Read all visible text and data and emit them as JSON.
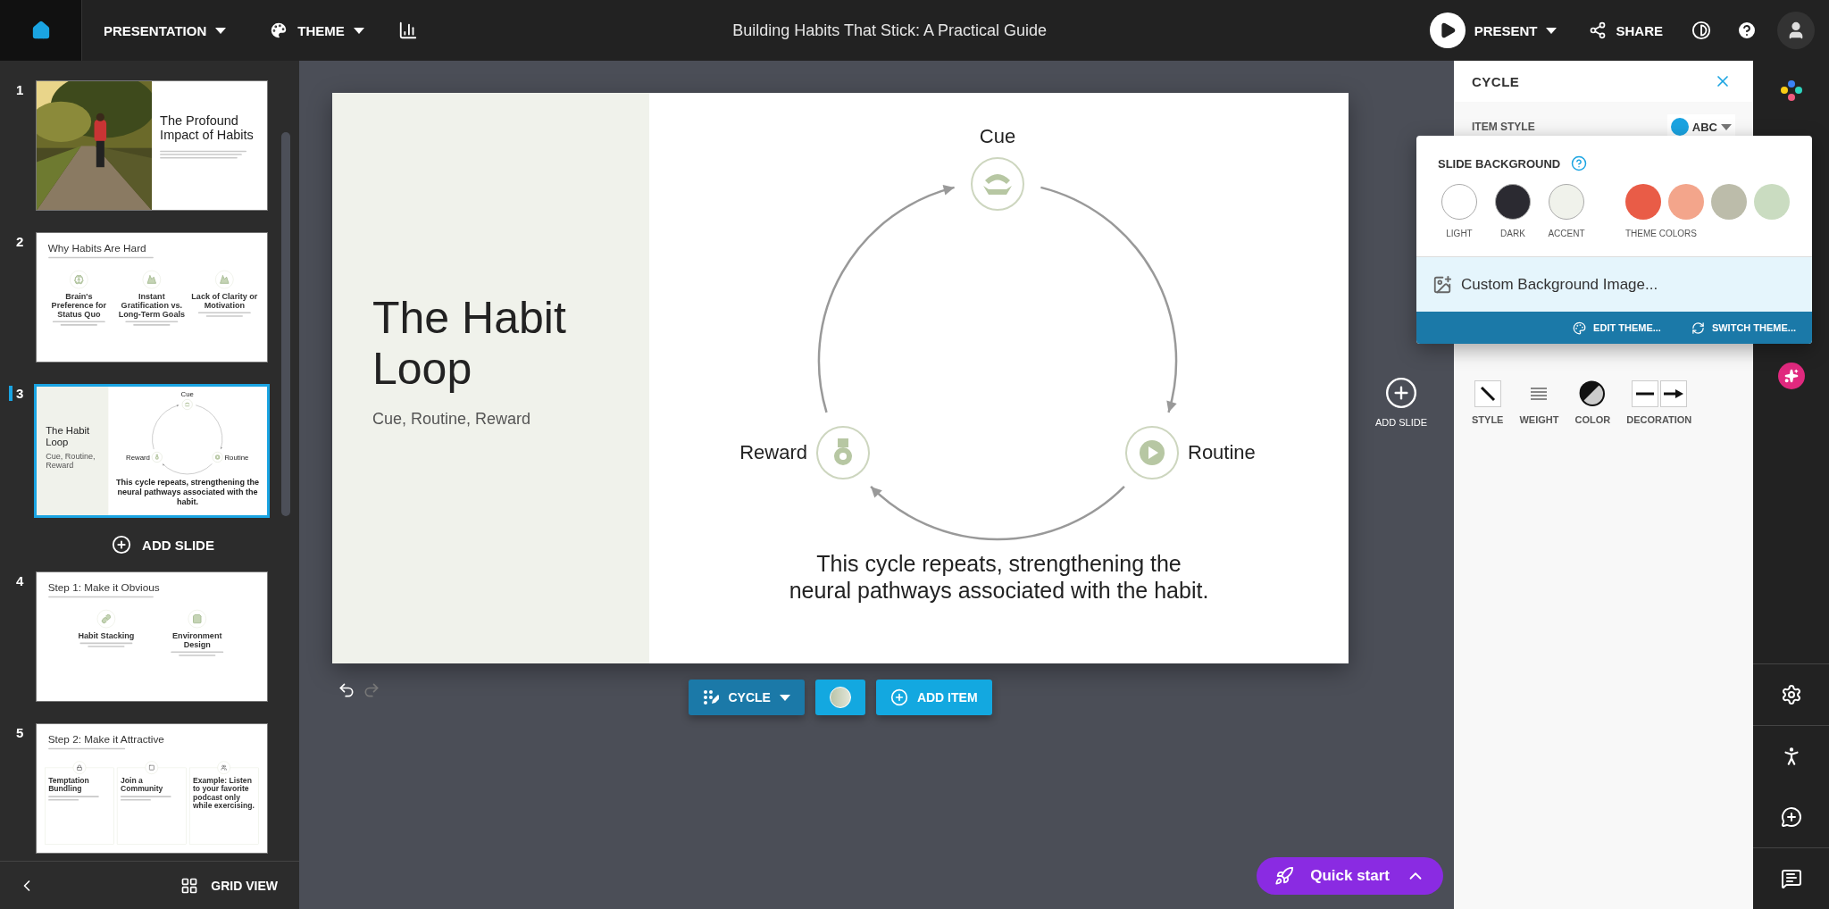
{
  "top_bar": {
    "menus": [
      {
        "label": "PRESENTATION",
        "kind": "presentation"
      },
      {
        "label": "THEME",
        "kind": "theme"
      }
    ],
    "title": "Building Habits That Stick: A Practical Guide",
    "present": "PRESENT",
    "share": "SHARE"
  },
  "slides_panel": {
    "slides": [
      {
        "number": "1",
        "selected": false,
        "kind": "photo_title",
        "title": "The Profound Impact of Habits"
      },
      {
        "number": "2",
        "selected": false,
        "kind": "icon_columns",
        "title": "Why Habits Are Hard",
        "items": [
          "Brain's Preference for Status Quo",
          "Instant Gratification vs. Long-Term Goals",
          "Lack of Clarity or Motivation"
        ]
      },
      {
        "number": "3",
        "selected": true,
        "kind": "cycle",
        "title": "The Habit Loop",
        "subtitle": "Cue, Routine, Reward",
        "nodes": [
          "Cue",
          "Routine",
          "Reward"
        ],
        "caption": "This cycle repeats, strengthening the neural pathways associated with the habit."
      },
      {
        "number": "4",
        "selected": false,
        "kind": "icon_columns",
        "title": "Step 1: Make it Obvious",
        "items": [
          "Habit Stacking",
          "Environment Design"
        ]
      },
      {
        "number": "5",
        "selected": false,
        "kind": "cards",
        "title": "Step 2: Make it Attractive",
        "items": [
          "Temptation Bundling",
          "Join a Community",
          "Example: Listen to your favorite podcast only while exercising."
        ]
      }
    ],
    "add_slide": "ADD SLIDE",
    "grid_view": "GRID VIEW"
  },
  "slide": {
    "kind": "cycle",
    "title": "The Habit Loop",
    "subtitle": "Cue, Routine, Reward",
    "nodes": [
      "Cue",
      "Routine",
      "Reward"
    ],
    "caption": "This cycle repeats, strengthening the neural pathways associated with the habit."
  },
  "slide_toolbar": {
    "cycle": "CYCLE",
    "add_item": "ADD ITEM"
  },
  "add_slide": "ADD SLIDE",
  "cycle_panel": {
    "title": "CYCLE",
    "item_style": "ITEM STYLE",
    "item_style_value": "ABC",
    "line_options": [
      "STYLE",
      "WEIGHT",
      "COLOR",
      "DECORATION"
    ]
  },
  "background_popover": {
    "title": "SLIDE BACKGROUND",
    "swatches": [
      {
        "label": "LIGHT",
        "color": "#ffffff"
      },
      {
        "label": "DARK",
        "color": "#2b2a31"
      },
      {
        "label": "ACCENT",
        "color": "#f0f2eb"
      }
    ],
    "theme_colors_label": "THEME COLORS",
    "theme_colors": [
      {
        "color": "#e95c47"
      },
      {
        "color": "#f3a58b"
      },
      {
        "color": "#bcbcaa"
      },
      {
        "color": "#cadcc1"
      }
    ],
    "custom_image": "Custom Background Image...",
    "footer": [
      "EDIT THEME...",
      "SWITCH THEME..."
    ]
  },
  "quick_start": "Quick start"
}
